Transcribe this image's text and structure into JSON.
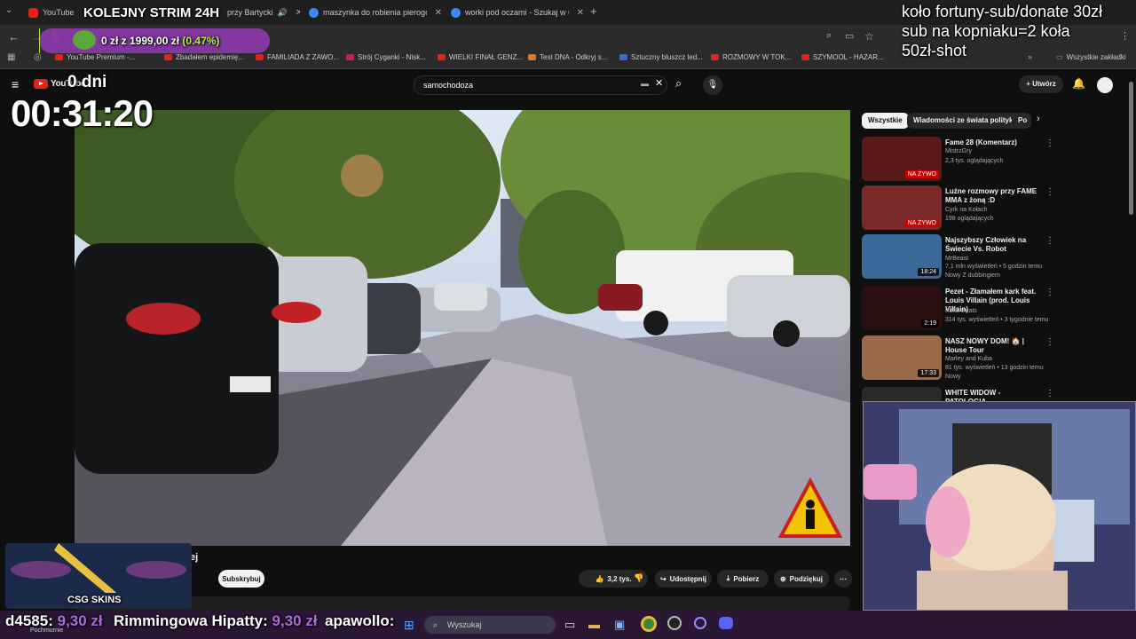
{
  "browser": {
    "tabs": [
      {
        "label": "YouTube",
        "color": "#e62117"
      },
      {
        "label": "przy Bartycki",
        "color": "#888888"
      },
      {
        "label": "maszynka do robienia pierogów",
        "color": "#4285f4"
      },
      {
        "label": "worki pod oczami - Szukaj w Go",
        "color": "#4285f4"
      }
    ],
    "bookmarks": [
      "YouTube Premium -...",
      "Zbadałem epidemię...",
      "FAMILIADA Z ZAWO...",
      "Strój Cyganki - Nisk...",
      "WIELKI FINAŁ GENZ...",
      "Test DNA - Odkryj s...",
      "Sztuczny bluszcz led...",
      "ROZMOWY W TOK...",
      "SZYMOOL - HAZAR...",
      "Wszystkie zakładki"
    ]
  },
  "youtube": {
    "logo": "YouTube",
    "search_value": "samochodoza",
    "create_label": "Utwórz",
    "subscribe_label": "Subskrybuj",
    "channel_fragment": "ej",
    "likes": "3,2 tys.",
    "share_label": "Udostępnij",
    "download_label": "Pobierz",
    "thanks_label": "Podziękuj",
    "chips": [
      "Wszystkie",
      "Wiadomości ze świata polityki",
      "Po"
    ],
    "recommendations": [
      {
        "title": "Fame 28 (Komentarz)",
        "channel": "MistrzGry",
        "meta": "2,3 tys. oglądających",
        "badge": "NA ŻYWO",
        "thumb_color": "#5a1a1a"
      },
      {
        "title": "Luźne rozmowy przy FAME MMA z żoną :D",
        "channel": "Cyrk na Kołach",
        "meta": "198 oglądających",
        "badge": "NA ŻYWO",
        "thumb_color": "#7a2a2a"
      },
      {
        "title": "Najszybszy Człowiek na Świecie Vs. Robot",
        "channel": "MrBeast",
        "meta": "7,1 mln wyświetleń • 5 godzin temu",
        "extra": "Nowy  Z dubbingiem",
        "badge": "18:24",
        "thumb_color": "#3a6a9a"
      },
      {
        "title": "Pezet - Złamałem kark feat. Louis Villain (prod. Louis Villain)",
        "channel": "Koka Beats",
        "meta": "314 tys. wyświetleń • 3 tygodnie temu",
        "badge": "2:19",
        "thumb_color": "#2a1010"
      },
      {
        "title": "NASZ NOWY DOM! 🏠 | House Tour",
        "channel": "Marley and Kuba",
        "meta": "81 tys. wyświetleń • 13 godzin temu",
        "extra": "Nowy",
        "badge": "17:33",
        "thumb_color": "#9a6a4a"
      },
      {
        "title": "WHITE WIDOW - PATOLOGIA",
        "channel": "",
        "meta": "",
        "badge": "",
        "thumb_color": "#2a2a2a"
      }
    ]
  },
  "overlay": {
    "stream_title": "KOLEJNY STRIM 24H",
    "goal_text": "0 zł z 1999,00 zł",
    "goal_percent": "(0.47%)",
    "goal_fraction": 0.0047,
    "days": "0 dni",
    "timer": "00:31:20",
    "wheel_line1": "koło fortuny-sub/donate 30zł",
    "wheel_line2": "sub na kopniaku=2 koła",
    "wheel_line3": "50zł-shot",
    "sponsor": "CSG SKINS",
    "donations_ticker": [
      {
        "name": "d4585:",
        "amount": "9,30 zł"
      },
      {
        "name": "Rimmingowa Hipatty:",
        "amount": "9,30 zł"
      },
      {
        "name": "apawollo:",
        "amount": ""
      }
    ],
    "ticker_sub": "Pochmurnie",
    "taskbar_search": "Wyszukaj"
  }
}
